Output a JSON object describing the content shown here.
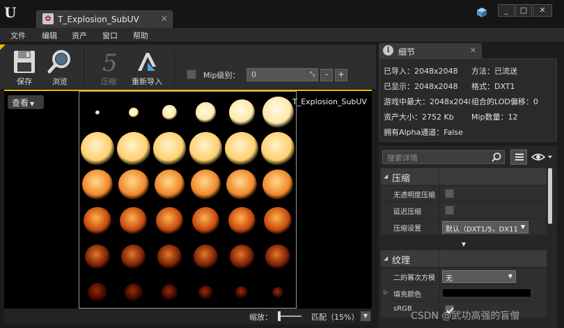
{
  "window": {
    "tab_title": "T_Explosion_SubUV",
    "tab_close": "✕",
    "min_label": "_",
    "max_label": "□",
    "close_label": "✕"
  },
  "menu": [
    "文件",
    "编辑",
    "资产",
    "窗口",
    "帮助"
  ],
  "toolbar": {
    "save": "保存",
    "browse": "浏览",
    "compress": "压缩",
    "reimport": "重新导入",
    "mip_label": "Mip级别：",
    "mip_value": "0",
    "mip_minus": "-",
    "mip_plus": "+"
  },
  "viewport": {
    "view_button": "查看",
    "texture_name": "T_Explosion_SubUV"
  },
  "zoom": {
    "label": "缩放：",
    "value": "匹配（15%）"
  },
  "details_tab": {
    "title": "细节",
    "close": "✕"
  },
  "info": {
    "imported": "已导入：2048x2048",
    "method": "方法：已流送",
    "displayed": "已显示：2048x2048",
    "format": "格式：DXT1",
    "max_ingame": "游戏中最大：2048x2048",
    "lod_bias": "组合的LOD偏移：0",
    "resource_size": "资产大小：2752 Kb",
    "mip_count": "Mip数量：12",
    "has_alpha": "拥有Alpha通道：False"
  },
  "details": {
    "search_placeholder": "搜索详情",
    "categories": {
      "compression": "压缩",
      "texture": "纹理"
    },
    "props": {
      "compress_no_alpha": "无透明度压缩",
      "defer_compression": "延迟压缩",
      "compression_settings": "压缩设置",
      "compression_settings_value": "默认（DXT1/5，DX11",
      "power_of_two": "二的幂次方模",
      "power_of_two_value": "无",
      "fill_color": "填充颜色",
      "srgb": "sRGB"
    }
  },
  "watermark": "CSDN @武功高强的盲僧"
}
